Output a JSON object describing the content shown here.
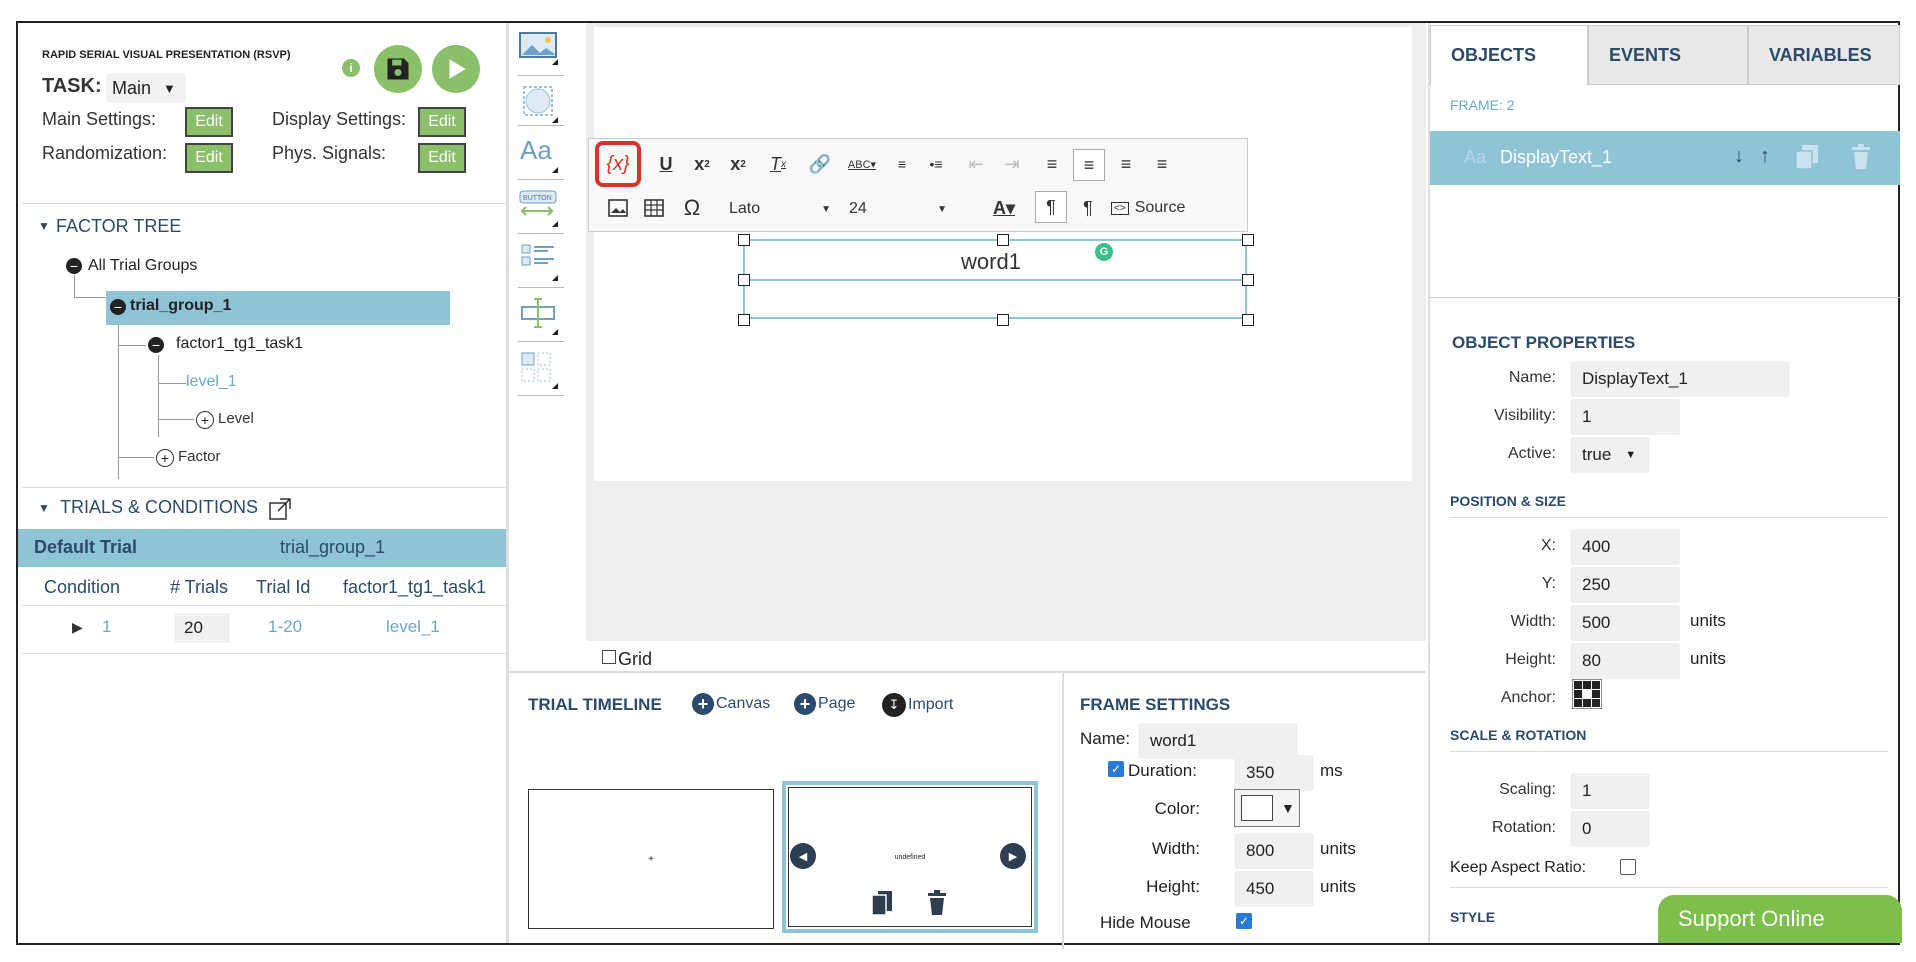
{
  "header": {
    "app_title": "RAPID SERIAL VISUAL PRESENTATION (RSVP)",
    "task_label": "TASK:",
    "task_value": "Main",
    "main_settings_label": "Main Settings:",
    "display_settings_label": "Display Settings:",
    "randomization_label": "Randomization:",
    "phys_signals_label": "Phys. Signals:",
    "edit_label": "Edit"
  },
  "factor_tree": {
    "title": "FACTOR TREE",
    "all_groups": "All Trial Groups",
    "group": "trial_group_1",
    "factor": "factor1_tg1_task1",
    "level": "level_1",
    "add_level": "Level",
    "add_factor": "Factor"
  },
  "trials": {
    "title": "TRIALS & CONDITIONS",
    "default_trial": "Default Trial",
    "default_group": "trial_group_1",
    "headers": [
      "Condition",
      "# Trials",
      "Trial Id",
      "factor1_tg1_task1"
    ],
    "row": {
      "condition": "1",
      "trials": "20",
      "trial_id": "1-20",
      "level": "level_1"
    }
  },
  "editor": {
    "font": "Lato",
    "size": "24",
    "source_label": "Source",
    "canvas_text": "word1",
    "grid_label": "Grid"
  },
  "timeline": {
    "title": "TRIAL TIMELINE",
    "canvas_btn": "Canvas",
    "page_btn": "Page",
    "import_btn": "Import",
    "frame1_text": "+",
    "frame2_text": "undefined"
  },
  "frame_settings": {
    "title": "FRAME SETTINGS",
    "name_label": "Name:",
    "name_value": "word1",
    "duration_label": "Duration:",
    "duration_value": "350",
    "duration_unit": "ms",
    "color_label": "Color:",
    "width_label": "Width:",
    "width_value": "800",
    "height_label": "Height:",
    "height_value": "450",
    "unit": "units",
    "hide_mouse_label": "Hide Mouse"
  },
  "right_panel": {
    "tabs": [
      "OBJECTS",
      "EVENTS",
      "VARIABLES"
    ],
    "frame_label": "FRAME: 2",
    "object_name": "DisplayText_1",
    "object_properties_title": "OBJECT PROPERTIES",
    "name_label": "Name:",
    "name_value": "DisplayText_1",
    "visibility_label": "Visibility:",
    "visibility_value": "1",
    "active_label": "Active:",
    "active_value": "true",
    "position_title": "POSITION & SIZE",
    "x_label": "X:",
    "x_value": "400",
    "y_label": "Y:",
    "y_value": "250",
    "width_label": "Width:",
    "width_value": "500",
    "height_label": "Height:",
    "height_value": "80",
    "unit": "units",
    "anchor_label": "Anchor:",
    "scale_title": "SCALE & ROTATION",
    "scaling_label": "Scaling:",
    "scaling_value": "1",
    "rotation_label": "Rotation:",
    "rotation_value": "0",
    "keep_aspect_label": "Keep Aspect Ratio:",
    "style_title": "STYLE"
  },
  "support": {
    "label": "Support Online"
  },
  "colors": {
    "accent_green": "#8cbf6a",
    "selection_blue": "#8fc3d6",
    "title_navy": "#2c4a6b",
    "support_green": "#7cbf4a"
  }
}
